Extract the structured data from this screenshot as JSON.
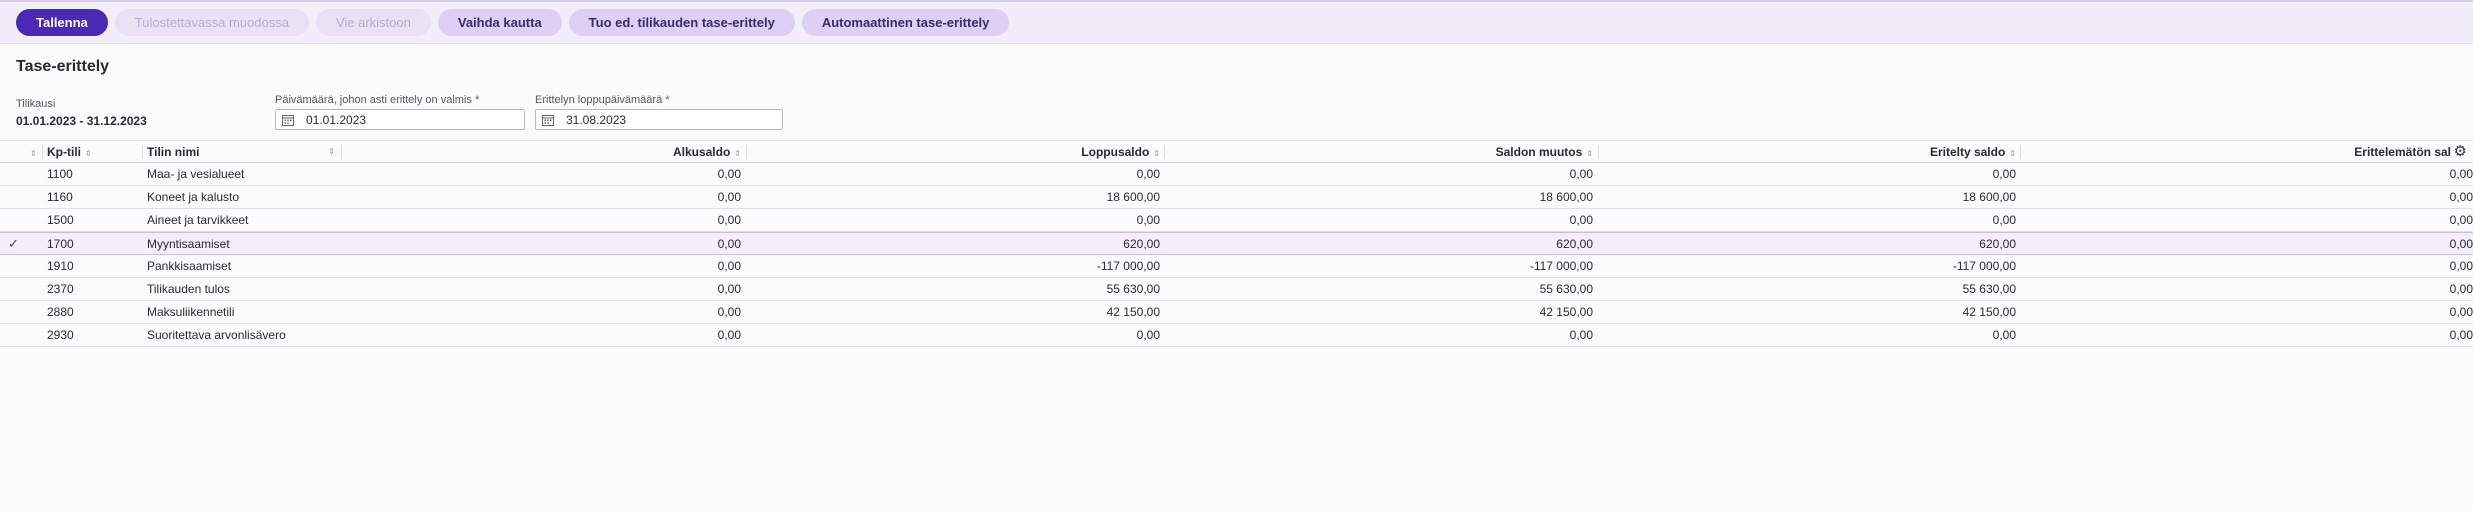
{
  "toolbar": {
    "save": "Tallenna",
    "print_format": "Tulostettavassa muodossa",
    "archive": "Vie arkistoon",
    "change_via": "Vaihda kautta",
    "import_prev": "Tuo ed. tilikauden tase-erittely",
    "auto": "Automaattinen tase-erittely"
  },
  "page": {
    "title": "Tase-erittely",
    "period_label": "Tilikausi",
    "period_value": "01.01.2023 - 31.12.2023",
    "ready_label": "Päivämäärä, johon asti erittely on valmis",
    "ready_value": "01.01.2023",
    "end_label": "Erittelyn loppupäivämäärä",
    "end_value": "31.08.2023",
    "required_mark": "*"
  },
  "table": {
    "columns": {
      "account": "Kp-tili",
      "name": "Tilin nimi",
      "opening": "Alkusaldo",
      "closing": "Loppusaldo",
      "change": "Saldon muutos",
      "itemized": "Eritelty saldo",
      "unitemized": "Erittelemätön sal"
    },
    "sort_glyph": "⇕",
    "check_glyph": "✓",
    "rows": [
      {
        "account": "1100",
        "name": "Maa- ja vesialueet",
        "opening": "0,00",
        "closing": "0,00",
        "change": "0,00",
        "itemized": "0,00",
        "unitemized": "0,00",
        "selected": false
      },
      {
        "account": "1160",
        "name": "Koneet ja kalusto",
        "opening": "0,00",
        "closing": "18 600,00",
        "change": "18 600,00",
        "itemized": "18 600,00",
        "unitemized": "0,00",
        "selected": false
      },
      {
        "account": "1500",
        "name": "Aineet ja tarvikkeet",
        "opening": "0,00",
        "closing": "0,00",
        "change": "0,00",
        "itemized": "0,00",
        "unitemized": "0,00",
        "selected": false
      },
      {
        "account": "1700",
        "name": "Myyntisaamiset",
        "opening": "0,00",
        "closing": "620,00",
        "change": "620,00",
        "itemized": "620,00",
        "unitemized": "0,00",
        "selected": true
      },
      {
        "account": "1910",
        "name": "Pankkisaamiset",
        "opening": "0,00",
        "closing": "-117 000,00",
        "change": "-117 000,00",
        "itemized": "-117 000,00",
        "unitemized": "0,00",
        "selected": false
      },
      {
        "account": "2370",
        "name": "Tilikauden tulos",
        "opening": "0,00",
        "closing": "55 630,00",
        "change": "55 630,00",
        "itemized": "55 630,00",
        "unitemized": "0,00",
        "selected": false
      },
      {
        "account": "2880",
        "name": "Maksuliikennetili",
        "opening": "0,00",
        "closing": "42 150,00",
        "change": "42 150,00",
        "itemized": "42 150,00",
        "unitemized": "0,00",
        "selected": false
      },
      {
        "account": "2930",
        "name": "Suoritettava arvonlisävero",
        "opening": "0,00",
        "closing": "0,00",
        "change": "0,00",
        "itemized": "0,00",
        "unitemized": "0,00",
        "selected": false
      }
    ]
  },
  "colors": {
    "primary": "#4b28b6",
    "secondary_button": "#ddd0f4",
    "toolbar_bg": "#f2eef9",
    "selected_row": "#f3eefb"
  },
  "icons": {
    "calendar": "calendar-icon",
    "settings": "gear-icon",
    "sort": "sort-icon",
    "check": "check-icon"
  }
}
